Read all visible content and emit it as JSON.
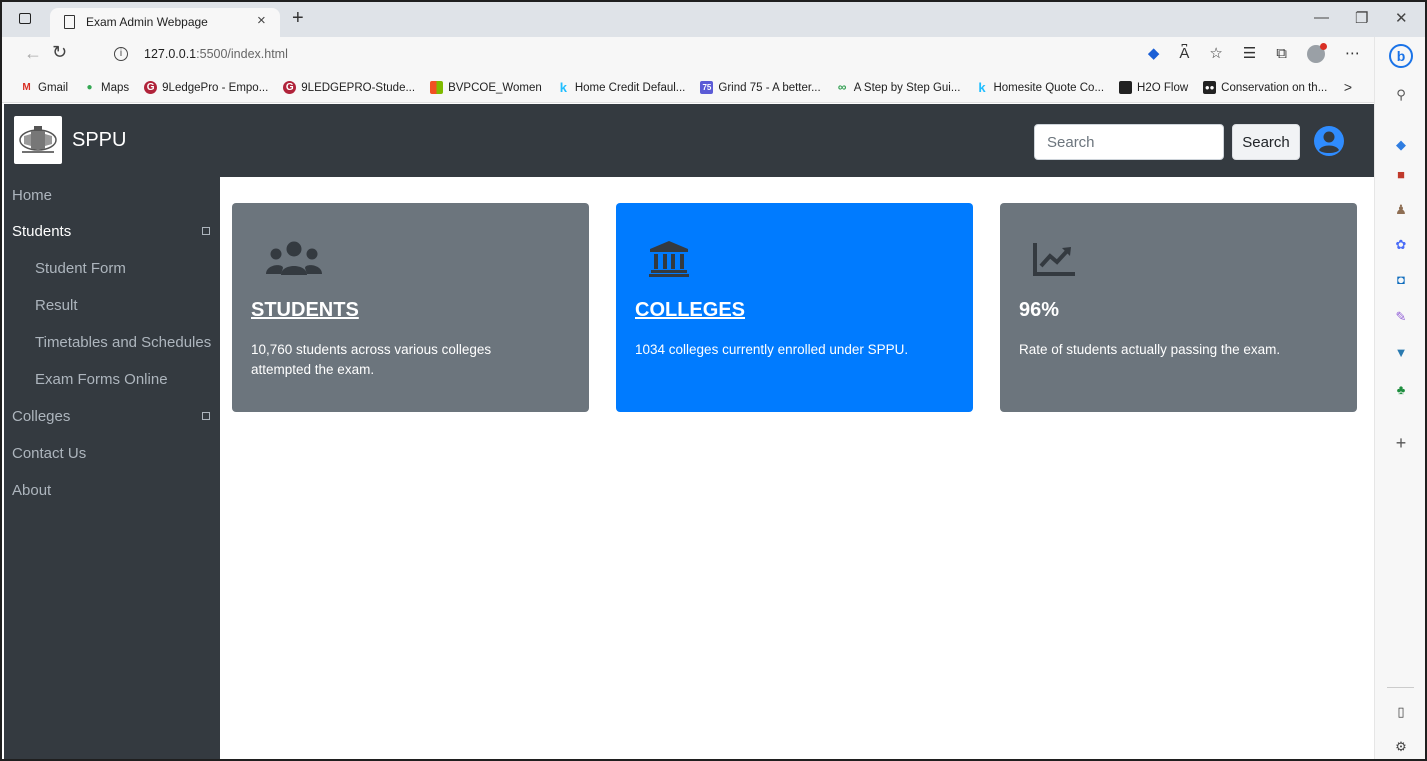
{
  "browser": {
    "tab_title": "Exam Admin Webpage",
    "tab_close": "×",
    "new_tab": "+",
    "url_host": "127.0.0.1",
    "url_rest": ":5500/index.html",
    "bookmarks": [
      {
        "label": "Gmail",
        "icon": "M",
        "color": "#d93025"
      },
      {
        "label": "Maps",
        "icon": "●",
        "color": "#34a853"
      },
      {
        "label": "9LedgePro - Empo...",
        "icon": "G",
        "color": "#b0233a"
      },
      {
        "label": "9LEDGEPRO-Stude...",
        "icon": "G",
        "color": "#b0233a"
      },
      {
        "label": "BVPCOE_Women",
        "icon": "■",
        "color": "#f25022"
      },
      {
        "label": "Home Credit Defaul...",
        "icon": "k",
        "color": "#20beff"
      },
      {
        "label": "Grind 75 - A better...",
        "icon": "75",
        "color": "#5b5bd6"
      },
      {
        "label": "A Step by Step Gui...",
        "icon": "∞",
        "color": "#2e9e4f"
      },
      {
        "label": "Homesite Quote Co...",
        "icon": "k",
        "color": "#20beff"
      },
      {
        "label": "H2O Flow",
        "icon": "▣",
        "color": "#222222"
      },
      {
        "label": "Conservation on th...",
        "icon": "●",
        "color": "#222222"
      }
    ],
    "bookmarks_more": ">"
  },
  "navbar": {
    "brand": "SPPU",
    "search_placeholder": "Search",
    "search_button": "Search"
  },
  "sidebar": {
    "items": [
      {
        "label": "Home",
        "type": "top",
        "active": false
      },
      {
        "label": "Students",
        "type": "top",
        "active": true,
        "expandable": true
      },
      {
        "label": "Student Form",
        "type": "sub"
      },
      {
        "label": "Result",
        "type": "sub"
      },
      {
        "label": "Timetables and Schedules",
        "type": "sub"
      },
      {
        "label": "Exam Forms Online",
        "type": "sub"
      },
      {
        "label": "Colleges",
        "type": "top",
        "active": false,
        "expandable": true
      },
      {
        "label": "Contact Us",
        "type": "top",
        "active": false
      },
      {
        "label": "About",
        "type": "top",
        "active": false
      }
    ]
  },
  "cards": [
    {
      "title": "STUDENTS",
      "text": "10,760 students across various colleges attempted the exam.",
      "icon": "users-icon",
      "color": "#6c757d"
    },
    {
      "title": "COLLEGES",
      "text": "1034 colleges currently enrolled under SPPU.",
      "icon": "institution-icon",
      "color": "#007bff"
    },
    {
      "title": "96%",
      "text": "Rate of students actually passing the exam.",
      "icon": "chart-line-icon",
      "color": "#6c757d"
    }
  ],
  "colors": {
    "navbar": "#343a40",
    "primary": "#007bff",
    "secondary": "#6c757d"
  }
}
